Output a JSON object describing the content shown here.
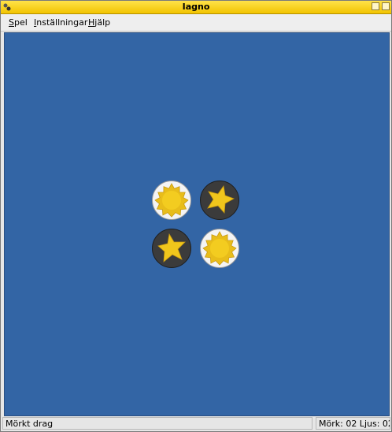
{
  "window": {
    "title": "Iagno"
  },
  "menu": {
    "items": [
      {
        "mnemonic": "S",
        "rest": "pel"
      },
      {
        "mnemonic": "I",
        "rest": "nställningar"
      },
      {
        "mnemonic": "H",
        "rest": "jälp"
      }
    ]
  },
  "board": {
    "color": "#3365a5",
    "pieces": [
      {
        "side": "light",
        "icon": "sun-icon"
      },
      {
        "side": "dark",
        "icon": "star-icon"
      },
      {
        "side": "dark",
        "icon": "star-icon"
      },
      {
        "side": "light",
        "icon": "sun-icon"
      }
    ]
  },
  "status": {
    "message": "Mörkt drag",
    "score_text": "Mörk: 02 Ljus: 02"
  }
}
